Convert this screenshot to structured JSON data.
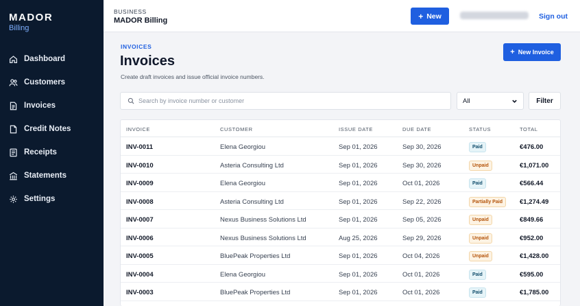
{
  "brand": {
    "name": "MADOR",
    "subtitle": "Billing"
  },
  "nav": [
    {
      "label": "Dashboard",
      "icon": "home-icon"
    },
    {
      "label": "Customers",
      "icon": "users-icon"
    },
    {
      "label": "Invoices",
      "icon": "document-icon"
    },
    {
      "label": "Credit Notes",
      "icon": "credit-note-icon"
    },
    {
      "label": "Receipts",
      "icon": "receipt-icon"
    },
    {
      "label": "Statements",
      "icon": "statements-icon"
    },
    {
      "label": "Settings",
      "icon": "gear-icon"
    }
  ],
  "topbar": {
    "label": "BUSINESS",
    "business": "MADOR Billing",
    "new_label": "New",
    "signout": "Sign out"
  },
  "page": {
    "crumb": "INVOICES",
    "title": "Invoices",
    "description": "Create draft invoices and issue official invoice numbers.",
    "new_invoice": "New Invoice"
  },
  "filters": {
    "search_placeholder": "Search by invoice number or customer",
    "status_selected": "All",
    "filter_button": "Filter"
  },
  "table": {
    "headers": [
      "INVOICE",
      "CUSTOMER",
      "ISSUE DATE",
      "DUE DATE",
      "STATUS",
      "TOTAL"
    ],
    "rows": [
      {
        "invoice": "INV-0011",
        "customer": "Elena Georgiou",
        "issue": "Sep 01, 2026",
        "due": "Sep 30, 2026",
        "status": "Paid",
        "total": "€476.00"
      },
      {
        "invoice": "INV-0010",
        "customer": "Asteria Consulting Ltd",
        "issue": "Sep 01, 2026",
        "due": "Sep 30, 2026",
        "status": "Unpaid",
        "total": "€1,071.00"
      },
      {
        "invoice": "INV-0009",
        "customer": "Elena Georgiou",
        "issue": "Sep 01, 2026",
        "due": "Oct 01, 2026",
        "status": "Paid",
        "total": "€566.44"
      },
      {
        "invoice": "INV-0008",
        "customer": "Asteria Consulting Ltd",
        "issue": "Sep 01, 2026",
        "due": "Sep 22, 2026",
        "status": "Partially Paid",
        "total": "€1,274.49"
      },
      {
        "invoice": "INV-0007",
        "customer": "Nexus Business Solutions Ltd",
        "issue": "Sep 01, 2026",
        "due": "Sep 05, 2026",
        "status": "Unpaid",
        "total": "€849.66"
      },
      {
        "invoice": "INV-0006",
        "customer": "Nexus Business Solutions Ltd",
        "issue": "Aug 25, 2026",
        "due": "Sep 29, 2026",
        "status": "Unpaid",
        "total": "€952.00"
      },
      {
        "invoice": "INV-0005",
        "customer": "BluePeak Properties Ltd",
        "issue": "Sep 01, 2026",
        "due": "Oct 04, 2026",
        "status": "Unpaid",
        "total": "€1,428.00"
      },
      {
        "invoice": "INV-0004",
        "customer": "Elena Georgiou",
        "issue": "Sep 01, 2026",
        "due": "Oct 01, 2026",
        "status": "Paid",
        "total": "€595.00"
      },
      {
        "invoice": "INV-0003",
        "customer": "BluePeak Properties Ltd",
        "issue": "Sep 01, 2026",
        "due": "Oct 01, 2026",
        "status": "Paid",
        "total": "€1,785.00"
      }
    ]
  },
  "colors": {
    "sidebar_bg": "#0b1a2e",
    "accent": "#1f5fe0",
    "paid": "#0f4c6b",
    "unpaid": "#b45309"
  }
}
